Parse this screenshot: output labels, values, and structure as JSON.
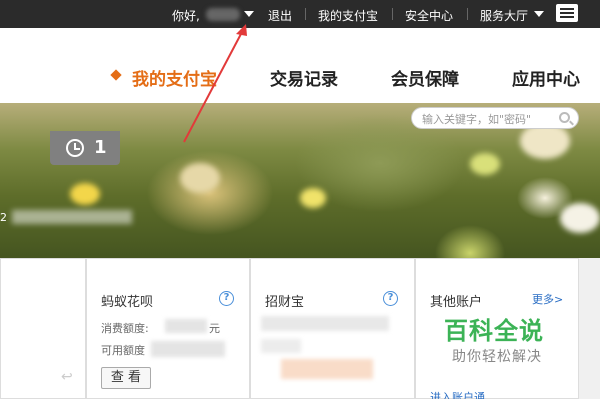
{
  "topbar": {
    "greeting": "你好,",
    "logout": "退出",
    "my_alipay": "我的支付宝",
    "security_center": "安全中心",
    "service_hall": "服务大厅"
  },
  "nav": {
    "items": [
      "我的支付宝",
      "交易记录",
      "会员保障",
      "应用中心"
    ]
  },
  "banner": {
    "search_placeholder": "输入关键字，如\"密码\"",
    "message_count": "1",
    "fragment": "2"
  },
  "cards": {
    "huabei": {
      "title": "蚂蚁花呗",
      "consume_label": "消费额度:",
      "consume_suffix": "元",
      "available_label": "可用额度",
      "view_button": "查 看"
    },
    "zhaocaibao": {
      "title": "招财宝"
    },
    "other": {
      "title": "其他账户",
      "more": "更多>",
      "footer": "进入账户通"
    }
  },
  "watermark": {
    "title": "百科全说",
    "subtitle": "助你轻松解决"
  },
  "colors": {
    "accent_orange": "#e46d16",
    "link_blue": "#2a6ec4",
    "watermark_green": "#3cb356",
    "annotation_red": "#e23a3a"
  }
}
